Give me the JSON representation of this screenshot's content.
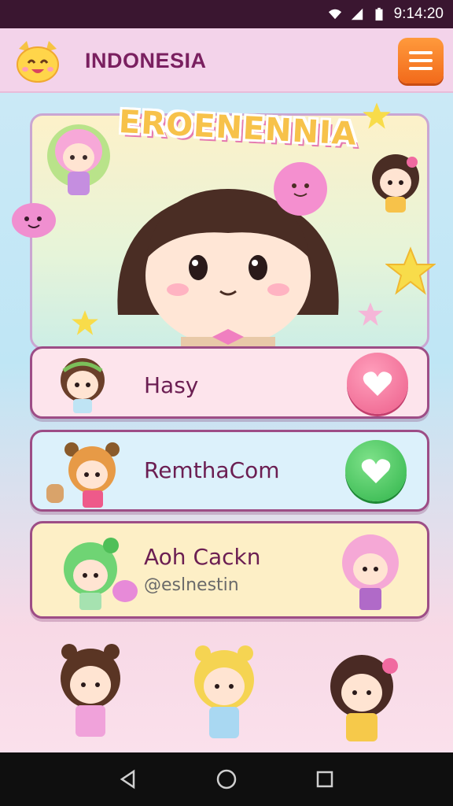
{
  "status_bar": {
    "time": "9:14:20"
  },
  "app_bar": {
    "title": "INDONESIA"
  },
  "hero": {
    "banner_text": "EROENENNIA"
  },
  "cards": [
    {
      "label": "Hasy",
      "button": "heart-button",
      "color": "#ec5e8a"
    },
    {
      "label": "RemthaCom",
      "button": "heart-button",
      "color": "#2fb44a"
    },
    {
      "label": "Aoh Cackn",
      "sublabel": "@eslnestin"
    }
  ],
  "colors": {
    "accent": "#f26a1b",
    "title": "#7a2060",
    "card_border": "#9d4d86"
  }
}
